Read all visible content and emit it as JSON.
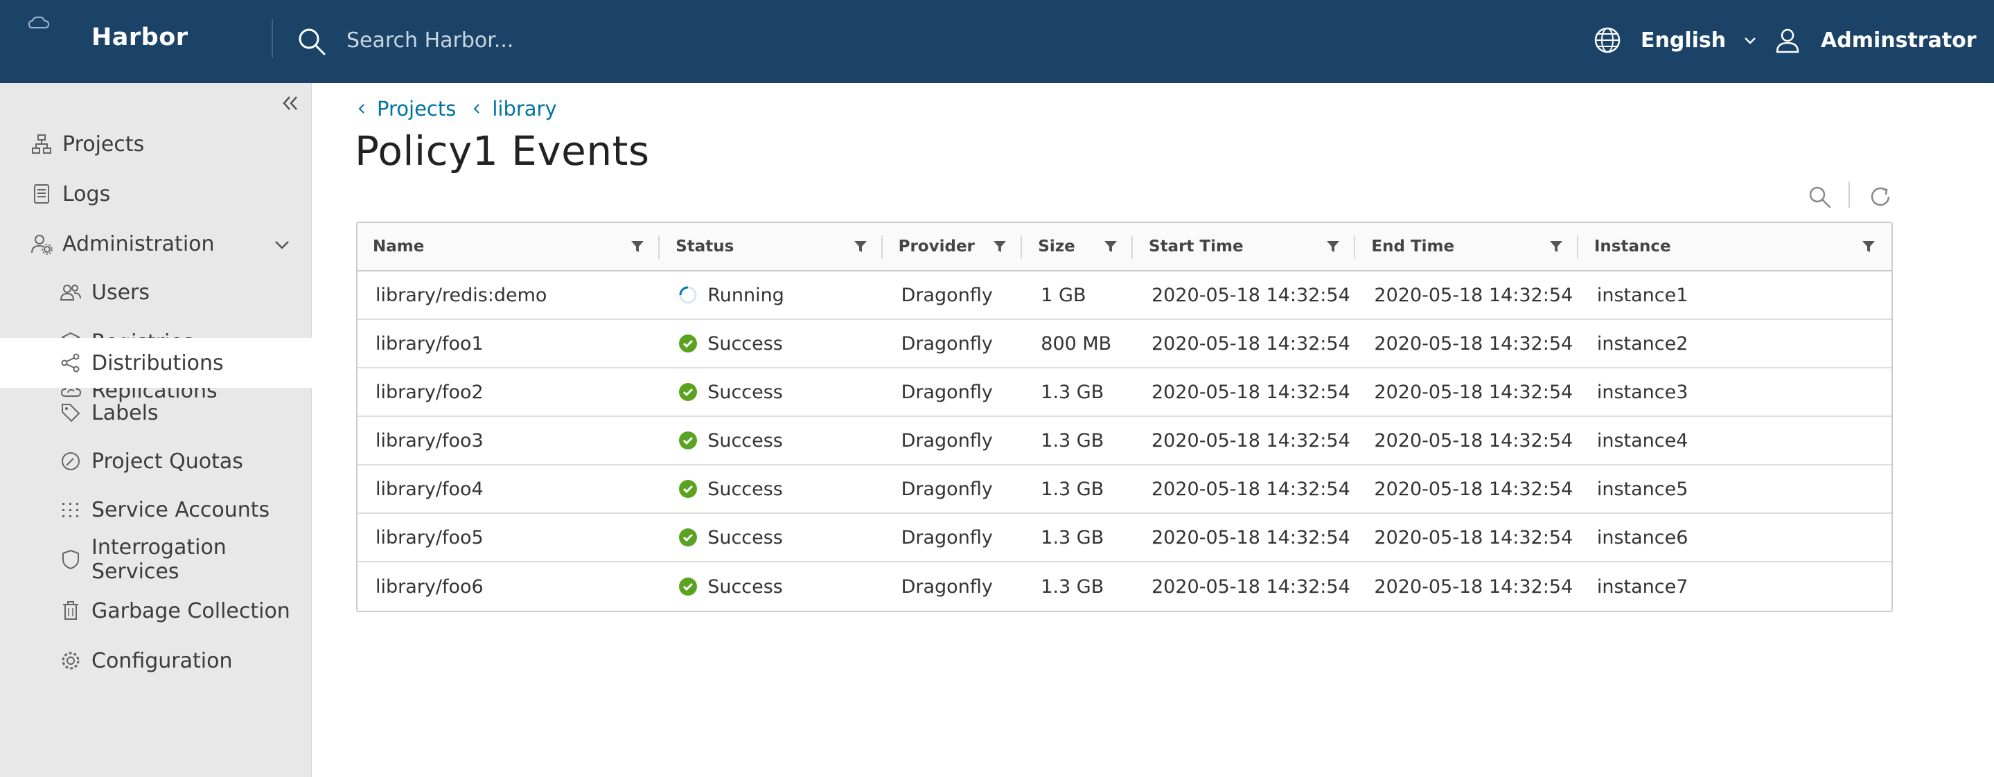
{
  "header": {
    "brand": "Harbor",
    "search_placeholder": "Search Harbor...",
    "language": "English",
    "user": "Adminstrator"
  },
  "sidebar": {
    "items": [
      {
        "label": "Projects",
        "icon": "projects-icon"
      },
      {
        "label": "Logs",
        "icon": "logs-icon"
      },
      {
        "label": "Administration",
        "icon": "administration-icon"
      },
      {
        "label": "Users",
        "icon": "users-icon"
      },
      {
        "label": "Registries",
        "icon": "registries-icon"
      },
      {
        "label": "Replications",
        "icon": "replications-icon"
      },
      {
        "label": "Distributions",
        "icon": "distributions-icon",
        "active": true
      },
      {
        "label": "Labels",
        "icon": "labels-icon"
      },
      {
        "label": "Project Quotas",
        "icon": "quotas-icon"
      },
      {
        "label": "Service Accounts",
        "icon": "service-accounts-icon"
      },
      {
        "label": "Interrogation Services",
        "icon": "interrogation-icon"
      },
      {
        "label": "Garbage Collection",
        "icon": "garbage-icon"
      },
      {
        "label": "Configuration",
        "icon": "configuration-icon"
      }
    ]
  },
  "breadcrumb": [
    "Projects",
    "library"
  ],
  "page_title": "Policy1 Events",
  "table": {
    "columns": [
      "Name",
      "Status",
      "Provider",
      "Size",
      "Start Time",
      "End Time",
      "Instance"
    ],
    "rows": [
      {
        "name": "library/redis:demo",
        "status": "Running",
        "provider": "Dragonfly",
        "size": "1 GB",
        "start": "2020-05-18 14:32:54",
        "end": "2020-05-18 14:32:54",
        "instance": "instance1"
      },
      {
        "name": "library/foo1",
        "status": "Success",
        "provider": "Dragonfly",
        "size": "800 MB",
        "start": "2020-05-18 14:32:54",
        "end": "2020-05-18 14:32:54",
        "instance": "instance2"
      },
      {
        "name": "library/foo2",
        "status": "Success",
        "provider": "Dragonfly",
        "size": "1.3 GB",
        "start": "2020-05-18 14:32:54",
        "end": "2020-05-18 14:32:54",
        "instance": "instance3"
      },
      {
        "name": "library/foo3",
        "status": "Success",
        "provider": "Dragonfly",
        "size": "1.3 GB",
        "start": "2020-05-18 14:32:54",
        "end": "2020-05-18 14:32:54",
        "instance": "instance4"
      },
      {
        "name": "library/foo4",
        "status": "Success",
        "provider": "Dragonfly",
        "size": "1.3 GB",
        "start": "2020-05-18 14:32:54",
        "end": "2020-05-18 14:32:54",
        "instance": "instance5"
      },
      {
        "name": "library/foo5",
        "status": "Success",
        "provider": "Dragonfly",
        "size": "1.3 GB",
        "start": "2020-05-18 14:32:54",
        "end": "2020-05-18 14:32:54",
        "instance": "instance6"
      },
      {
        "name": "library/foo6",
        "status": "Success",
        "provider": "Dragonfly",
        "size": "1.3 GB",
        "start": "2020-05-18 14:32:54",
        "end": "2020-05-18 14:32:54",
        "instance": "instance7"
      }
    ]
  },
  "colors": {
    "header_bg": "#1b4367",
    "link": "#0072a3",
    "success": "#5aa220",
    "running": "#0079b8",
    "sidebar_bg": "#e8e8e8"
  }
}
